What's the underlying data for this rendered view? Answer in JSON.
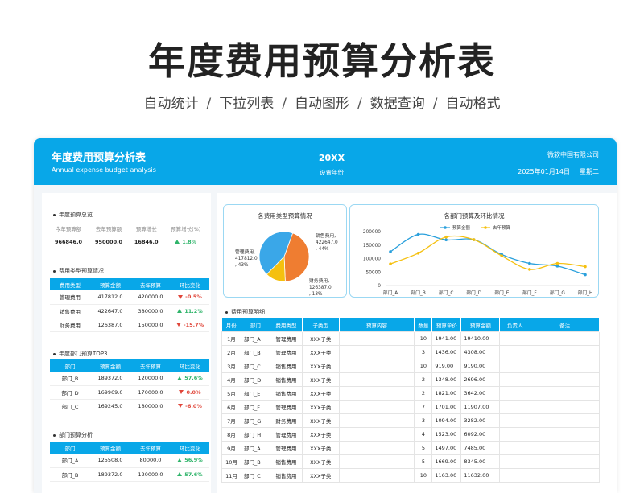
{
  "hero": {
    "title": "年度费用预算分析表",
    "features": [
      "自动统计",
      "下拉列表",
      "自动图形",
      "数据查询",
      "自动格式"
    ],
    "separator": "/"
  },
  "banner": {
    "title_cn": "年度费用预算分析表",
    "title_en": "Annual expense budget analysis",
    "year": "20XX",
    "year_label": "设置年份",
    "company": "微软中国有限公司",
    "date": "2025年01月14日",
    "weekday": "星期二",
    "bg_color": "#08a7e8"
  },
  "overview": {
    "title": "年度预算总览",
    "headers": [
      "今年预算额",
      "去年预算额",
      "预算增长",
      "预算增长(%)"
    ],
    "values": [
      "966846.0",
      "950000.0",
      "16846.0",
      "1.8%"
    ],
    "trend": "up"
  },
  "type_budget": {
    "title": "费用类型预算情况",
    "headers": [
      "费用类型",
      "预算金额",
      "去年预算",
      "环比变化"
    ],
    "rows": [
      {
        "name": "管理费用",
        "budget": "417812.0",
        "last": "420000.0",
        "change": "-0.5%",
        "trend": "down"
      },
      {
        "name": "销售费用",
        "budget": "422647.0",
        "last": "380000.0",
        "change": "11.2%",
        "trend": "up"
      },
      {
        "name": "财务费用",
        "budget": "126387.0",
        "last": "150000.0",
        "change": "-15.7%",
        "trend": "down"
      }
    ]
  },
  "dept_top3": {
    "title": "年度部门预算TOP3",
    "headers": [
      "部门",
      "预算金额",
      "去年预算",
      "环比变化"
    ],
    "rows": [
      {
        "name": "部门_B",
        "budget": "189372.0",
        "last": "120000.0",
        "change": "57.6%",
        "trend": "up"
      },
      {
        "name": "部门_D",
        "budget": "169969.0",
        "last": "170000.0",
        "change": "0.0%",
        "trend": "down"
      },
      {
        "name": "部门_C",
        "budget": "169245.0",
        "last": "180000.0",
        "change": "-6.0%",
        "trend": "down"
      }
    ]
  },
  "dept_analysis": {
    "title": "部门预算分析",
    "headers": [
      "部门",
      "预算金额",
      "去年预算",
      "环比变化"
    ],
    "rows": [
      {
        "name": "部门_A",
        "budget": "125508.0",
        "last": "80000.0",
        "change": "56.9%",
        "trend": "up"
      },
      {
        "name": "部门_B",
        "budget": "189372.0",
        "last": "120000.0",
        "change": "57.6%",
        "trend": "up"
      }
    ]
  },
  "detail": {
    "title": "费用预算明细",
    "headers": [
      "月份",
      "部门",
      "费用类型",
      "子类型",
      "预算内容",
      "数量",
      "预算单价",
      "预算金额",
      "负责人",
      "备注"
    ],
    "rows": [
      [
        "1月",
        "部门_A",
        "管理费用",
        "XXX子类",
        "",
        "10",
        "1941.00",
        "19410.00",
        "",
        ""
      ],
      [
        "2月",
        "部门_B",
        "管理费用",
        "XXX子类",
        "",
        "3",
        "1436.00",
        "4308.00",
        "",
        ""
      ],
      [
        "3月",
        "部门_C",
        "销售费用",
        "XXX子类",
        "",
        "10",
        "919.00",
        "9190.00",
        "",
        ""
      ],
      [
        "4月",
        "部门_D",
        "销售费用",
        "XXX子类",
        "",
        "2",
        "1348.00",
        "2696.00",
        "",
        ""
      ],
      [
        "5月",
        "部门_E",
        "销售费用",
        "XXX子类",
        "",
        "2",
        "1821.00",
        "3642.00",
        "",
        ""
      ],
      [
        "6月",
        "部门_F",
        "管理费用",
        "XXX子类",
        "",
        "7",
        "1701.00",
        "11907.00",
        "",
        ""
      ],
      [
        "7月",
        "部门_G",
        "财务费用",
        "XXX子类",
        "",
        "3",
        "1094.00",
        "3282.00",
        "",
        ""
      ],
      [
        "8月",
        "部门_H",
        "管理费用",
        "XXX子类",
        "",
        "4",
        "1523.00",
        "6092.00",
        "",
        ""
      ],
      [
        "9月",
        "部门_A",
        "管理费用",
        "XXX子类",
        "",
        "5",
        "1497.00",
        "7485.00",
        "",
        ""
      ],
      [
        "10月",
        "部门_B",
        "销售费用",
        "XXX子类",
        "",
        "5",
        "1669.00",
        "8345.00",
        "",
        ""
      ],
      [
        "11月",
        "部门_C",
        "销售费用",
        "XXX子类",
        "",
        "10",
        "1163.00",
        "11632.00",
        "",
        ""
      ]
    ]
  },
  "chart_data": [
    {
      "type": "pie",
      "title": "各费用类型预算情况",
      "categories": [
        "管理费用",
        "销售费用",
        "财务费用"
      ],
      "values": [
        417812.0,
        422647.0,
        126387.0
      ],
      "percents": [
        "43%",
        "44%",
        "13%"
      ],
      "labels": [
        "管理费用, 417812.0 , 43%",
        "销售费用, 422647.0 , 44%",
        "财务费用, 126387.0 , 13%"
      ],
      "colors": [
        "#3aa7e8",
        "#ef7d31",
        "#f5c00f"
      ]
    },
    {
      "type": "line",
      "title": "各部门预算及环比情况",
      "categories": [
        "部门_A",
        "部门_B",
        "部门_C",
        "部门_D",
        "部门_E",
        "部门_F",
        "部门_G",
        "部门_H"
      ],
      "series": [
        {
          "name": "预算金额",
          "values": [
            125508,
            189372,
            169245,
            169969,
            115000,
            82000,
            72000,
            40000
          ],
          "color": "#2aa0dc"
        },
        {
          "name": "去年预算",
          "values": [
            80000,
            120000,
            180000,
            170000,
            110000,
            60000,
            82000,
            70000
          ],
          "color": "#f5c00f"
        }
      ],
      "yticks": [
        "200000",
        "150000",
        "100000",
        "50000",
        "0"
      ],
      "ylim": [
        0,
        200000
      ],
      "legend": "top"
    }
  ]
}
